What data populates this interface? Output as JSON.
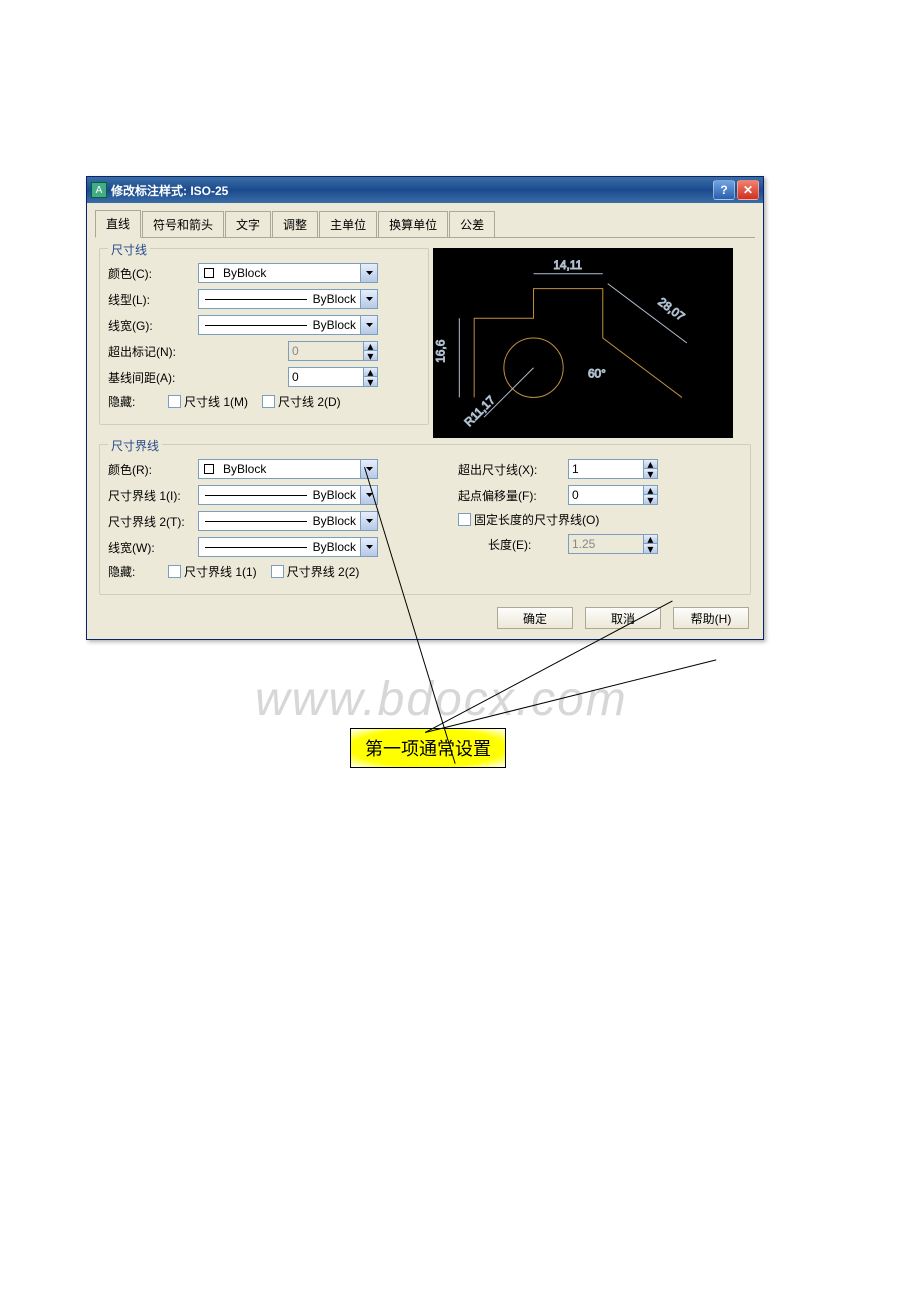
{
  "title": "修改标注样式: ISO-25",
  "tabs": [
    "直线",
    "符号和箭头",
    "文字",
    "调整",
    "主单位",
    "换算单位",
    "公差"
  ],
  "group_dimline": "尺寸线",
  "group_extline": "尺寸界线",
  "dl": {
    "color_lbl": "颜色(C):",
    "color_val": "ByBlock",
    "ltype_lbl": "线型(L):",
    "ltype_val": "ByBlock",
    "lweight_lbl": "线宽(G):",
    "lweight_val": "ByBlock",
    "extend_lbl": "超出标记(N):",
    "extend_val": "0",
    "spacing_lbl": "基线间距(A):",
    "spacing_val": "0",
    "hide_lbl": "隐藏:",
    "hide1": "尺寸线 1(M)",
    "hide2": "尺寸线 2(D)"
  },
  "el": {
    "color_lbl": "颜色(R):",
    "color_val": "ByBlock",
    "ext1_lbl": "尺寸界线 1(I):",
    "ext1_val": "ByBlock",
    "ext2_lbl": "尺寸界线 2(T):",
    "ext2_val": "ByBlock",
    "lweight_lbl": "线宽(W):",
    "lweight_val": "ByBlock",
    "hide_lbl": "隐藏:",
    "hide1": "尺寸界线 1(1)",
    "hide2": "尺寸界线 2(2)",
    "beyond_lbl": "超出尺寸线(X):",
    "beyond_val": "1",
    "offset_lbl": "起点偏移量(F):",
    "offset_val": "0",
    "fixed_lbl": "固定长度的尺寸界线(O)",
    "len_lbl": "长度(E):",
    "len_val": "1.25"
  },
  "preview": {
    "top": "14,11",
    "left": "16,6",
    "diag": "28,07",
    "angle": "60°",
    "radius": "R11,17"
  },
  "buttons": {
    "ok": "确定",
    "cancel": "取消",
    "help": "帮助(H)"
  },
  "callout": "第一项通常设置",
  "watermark": "www.bdocx.com"
}
